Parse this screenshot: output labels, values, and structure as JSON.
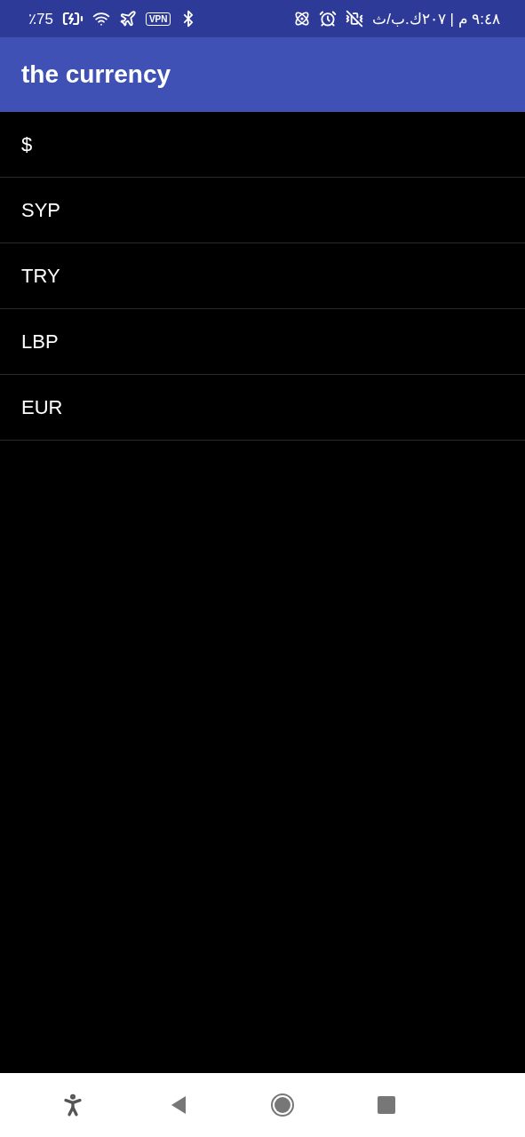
{
  "status_bar": {
    "battery": "٪75",
    "vpn": "VPN",
    "clock": "٩:٤٨ م | ٢٠٧ك.ب/ث"
  },
  "app_bar": {
    "title": "the currency"
  },
  "currencies": [
    {
      "label": "$"
    },
    {
      "label": "SYP"
    },
    {
      "label": "TRY"
    },
    {
      "label": "LBP"
    },
    {
      "label": "EUR"
    }
  ]
}
